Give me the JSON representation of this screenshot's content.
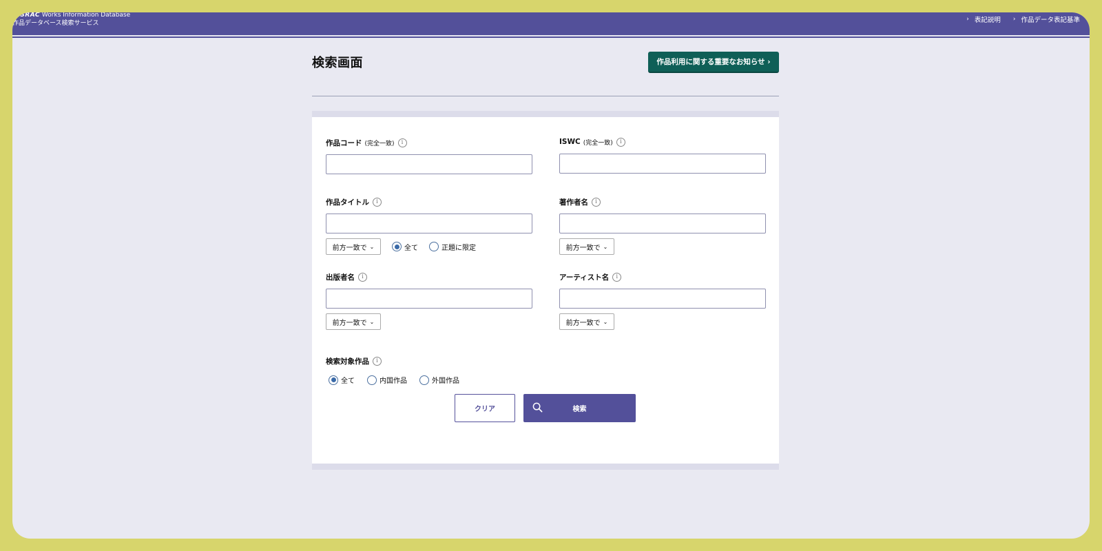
{
  "header": {
    "brand_logo": "JASRAC",
    "brand_db": "Works Information Database",
    "brand_service": "作品データベース検索サービス",
    "nav": [
      {
        "label": "表記説明"
      },
      {
        "label": "作品データ表記基準"
      }
    ]
  },
  "page": {
    "title": "検索画面",
    "notice_button": "作品利用に関する重要なお知らせ ›"
  },
  "form": {
    "work_code": {
      "label": "作品コード",
      "sub": "(完全一致)",
      "value": ""
    },
    "iswc": {
      "label": "ISWC",
      "sub": "(完全一致)",
      "value": ""
    },
    "work_title": {
      "label": "作品タイトル",
      "value": "",
      "match": "前方一致で",
      "radios": [
        {
          "label": "全て",
          "checked": true
        },
        {
          "label": "正題に限定",
          "checked": false
        }
      ]
    },
    "author": {
      "label": "著作者名",
      "value": "",
      "match": "前方一致で"
    },
    "publisher": {
      "label": "出版者名",
      "value": "",
      "match": "前方一致で"
    },
    "artist": {
      "label": "アーティスト名",
      "value": "",
      "match": "前方一致で"
    },
    "target": {
      "label": "検索対象作品",
      "radios": [
        {
          "label": "全て",
          "checked": true
        },
        {
          "label": "内国作品",
          "checked": false
        },
        {
          "label": "外国作品",
          "checked": false
        }
      ]
    },
    "clear_button": "クリア",
    "search_button": "検索"
  },
  "colors": {
    "header": "#53509a",
    "notice_button": "#0f5f57",
    "page_bg": "#e9e9f2",
    "outer_frame": "#d7d56c"
  }
}
